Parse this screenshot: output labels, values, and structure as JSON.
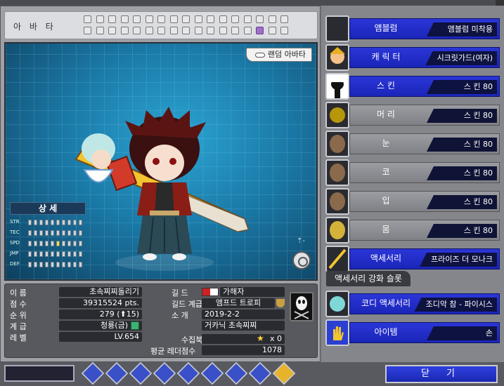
{
  "left": {
    "avatar_label": "아 바 타",
    "random_avatar_label": "랜덤 아바타",
    "detail_title": "상 세",
    "stats": [
      {
        "name": "STR",
        "level": 0
      },
      {
        "name": "TEC",
        "level": 0
      },
      {
        "name": "SPD",
        "level": 5
      },
      {
        "name": "JMP",
        "level": 0
      },
      {
        "name": "DEF",
        "level": 0
      }
    ]
  },
  "info": {
    "name_label": "이  름",
    "name": "초속찌찌돌리기",
    "score_label": "점  수",
    "score": "39315524 pts.",
    "rank_label": "순  위",
    "rank": "279 (⬆15)",
    "grade_label": "계  급",
    "grade": "청룡(금)",
    "level_label": "레  벨",
    "level": "LV.654",
    "guild_label": "길  드",
    "guild": "가해자",
    "guild_grade_label": "길드 계급",
    "guild_grade": "앰프드 트로피",
    "intro_label": "소  개",
    "intro_line1": "2019-2-2",
    "intro_line2": "거카닉 초속찌찌",
    "collection_label": "수집북",
    "collection": "x 0",
    "ladder_label": "평균 레더점수",
    "ladder": "1078"
  },
  "slots": [
    {
      "name": "앰블럼",
      "value": "앰블럼 미착용",
      "icon": "empty-slot-icon",
      "style": "blue"
    },
    {
      "name": "캐 릭 터",
      "value": "시크릿가드(여자)",
      "icon": "character-portrait-icon",
      "style": "blue"
    },
    {
      "name": "스  킨",
      "value": "스  킨 80",
      "icon": "skin-icon",
      "style": "blue"
    },
    {
      "name": "머  리",
      "value": "스  킨 80",
      "icon": "hair-icon",
      "style": "gray"
    },
    {
      "name": "눈",
      "value": "스  킨 80",
      "icon": "eye-icon",
      "style": "gray"
    },
    {
      "name": "코",
      "value": "스  킨 80",
      "icon": "nose-icon",
      "style": "gray"
    },
    {
      "name": "입",
      "value": "스  킨 80",
      "icon": "mouth-icon",
      "style": "gray"
    },
    {
      "name": "몸",
      "value": "스  킨 80",
      "icon": "body-icon",
      "style": "gray"
    },
    {
      "name": "액세서리",
      "value": "프라이즈 더 모나크",
      "icon": "sword-icon",
      "style": "blue"
    }
  ],
  "accessory_slot_label": "액세서리 강화 슬롯",
  "extra_slots": [
    {
      "name": "코디 액세서리",
      "value": "조디악 참 - 파이시스",
      "icon": "codi-accessory-icon",
      "style": "blue"
    },
    {
      "name": "아이템",
      "value": "손",
      "icon": "hand-icon",
      "style": "blue"
    }
  ],
  "close_label": "닫  기"
}
